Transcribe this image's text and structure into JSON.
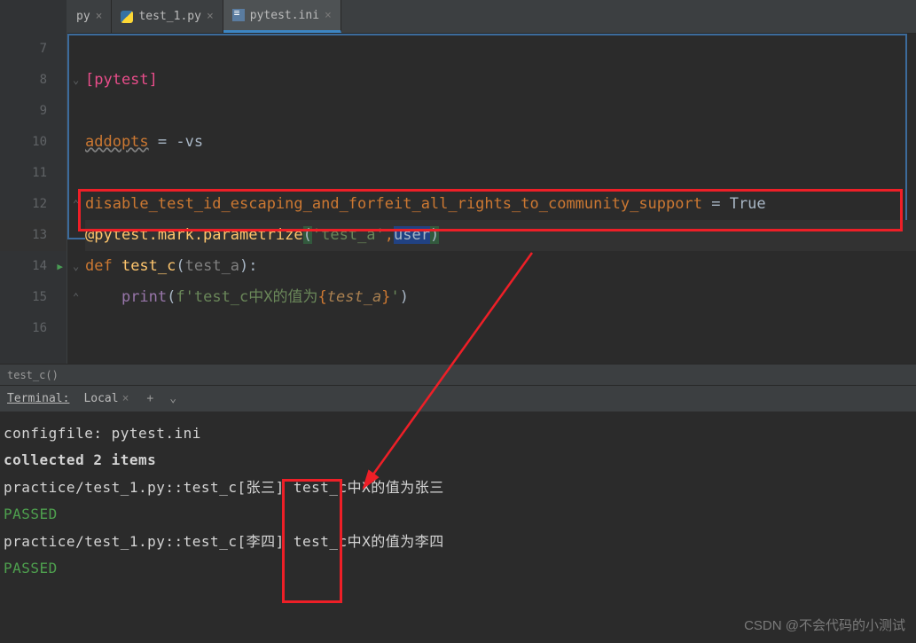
{
  "tabs": [
    {
      "label": "py",
      "icon": "py"
    },
    {
      "label": "test_1.py",
      "icon": "py"
    },
    {
      "label": "pytest.ini",
      "icon": "ini",
      "active": true
    }
  ],
  "gutter": {
    "start": 7,
    "lines": [
      "7",
      "8",
      "9",
      "10",
      "11",
      "12",
      "13",
      "14",
      "15",
      "16"
    ],
    "runLine": "14"
  },
  "code": {
    "l8_section": "[pytest]",
    "l10_key": "addopts",
    "l10_eq": " = ",
    "l10_val": "-vs",
    "l12_key": "disable_test_id_escaping_and_forfeit_all_rights_to_community_support",
    "l12_eq": " = ",
    "l12_val": "True",
    "l13_deco": "@pytest.mark.parametrize",
    "l13_open": "(",
    "l13_str": "'test_a'",
    "l13_comma": ",",
    "l13_user": "user",
    "l13_close": ")",
    "l14_def": "def ",
    "l14_fn": "test_c",
    "l14_open": "(",
    "l14_param": "test_a",
    "l14_close": "):",
    "l15_indent": "    ",
    "l15_print": "print",
    "l15_open": "(",
    "l15_f": "f'test_c中X的值为",
    "l15_brace_open": "{",
    "l15_var": "test_a",
    "l15_brace_close": "}",
    "l15_end": "'",
    "l15_close": ")"
  },
  "breadcrumb": "test_c()",
  "terminal": {
    "title": "Terminal:",
    "tab": "Local",
    "lines": {
      "configfile": "configfile: pytest.ini",
      "collected": "collected 2 items",
      "blank": "",
      "run1": "practice/test_1.py::test_c[张三] test_c中X的值为张三",
      "passed1": "PASSED",
      "run2": "practice/test_1.py::test_c[李四] test_c中X的值为李四",
      "passed2": "PASSED"
    }
  },
  "watermark": "CSDN @不会代码的小测试"
}
